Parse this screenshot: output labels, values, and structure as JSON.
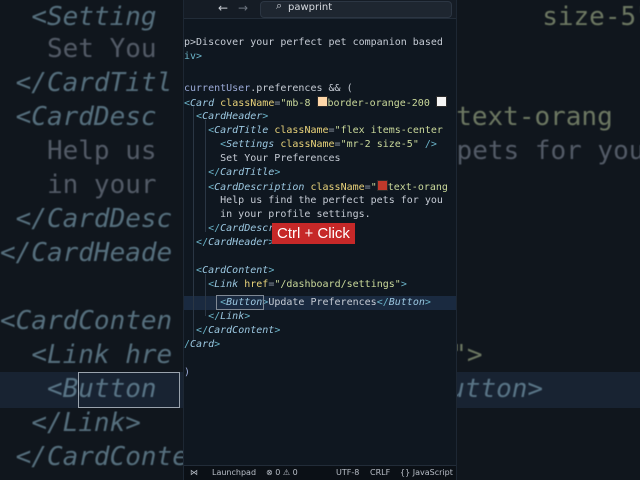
{
  "titlebar": {
    "back": "←",
    "forward": "→",
    "search_icon": "⌕",
    "search_text": "pawprint"
  },
  "overlay": {
    "shortcut_badge": "Ctrl + Click"
  },
  "code_lines": {
    "l0": "p>Discover your perfect pet companion based",
    "l1": "iv>",
    "l3_kw": "currentUser",
    "l3_rest": ".preferences && (",
    "l4_comp": "Card",
    "l4_attr": "className",
    "l4_str1": "\"mb-8 ",
    "l4_str2": "border-orange-200 ",
    "l5_comp": "CardHeader",
    "l6_comp": "CardTitle",
    "l6_attr": "className",
    "l6_str": "\"flex items-center",
    "l7_comp": "Settings",
    "l7_attr": "className",
    "l7_str": "\"mr-2 size-5\"",
    "l8_txt": "Set Your Preferences",
    "l9_comp": "CardTitle",
    "l10_comp": "CardDescription",
    "l10_attr": "className",
    "l10_str1": "\"",
    "l10_str2": "text-orang",
    "l11_txt": "Help us find the perfect pets for you",
    "l12_txt": "in your profile settings.",
    "l13_comp": "CardDescr",
    "l14_comp": "CardHeader",
    "l16_comp": "CardContent",
    "l17_comp": "Link",
    "l17_attr": "href",
    "l17_str": "\"/dashboard/settings\"",
    "l18_comp": "Button",
    "l18_txt": "Update Preferences",
    "l18_close": "Button",
    "l19_comp": "Link",
    "l20_comp": "CardContent",
    "l21_comp": "Card",
    "l23": ")"
  },
  "bg_lines": {
    "b0a": "<Setting",
    "b0b": " size-5\" />",
    "b1a": "Set You",
    "b2a": "</CardTitl",
    "b3a": "<CardDesc",
    "b3b": "\"",
    "b3c": "text-orang",
    "b4a": "Help us",
    "b4b": "pets for you",
    "b5a": "in your",
    "b6a": "</CardDesc",
    "b7a": "</CardHeade",
    "b9a": "<CardConten",
    "b10a": "<Link hre",
    "b10b": "ngs\">",
    "b11a": "<Button",
    "b11b": "s</Button>",
    "b12a": "</Link>",
    "b13a": "</CardConte"
  },
  "statusbar": {
    "launchpad": "Launchpad",
    "errors": "⊗ 0 ⚠ 0",
    "encoding": "UTF-8",
    "eol": "CRLF",
    "language": "{} JavaScript",
    "remote_icon": "⋈"
  },
  "colors": {
    "swatch_orange_light": "#ffd7a8",
    "swatch_white": "#f5f5f5",
    "swatch_red": "#c0392b",
    "badge": "#c62828"
  }
}
